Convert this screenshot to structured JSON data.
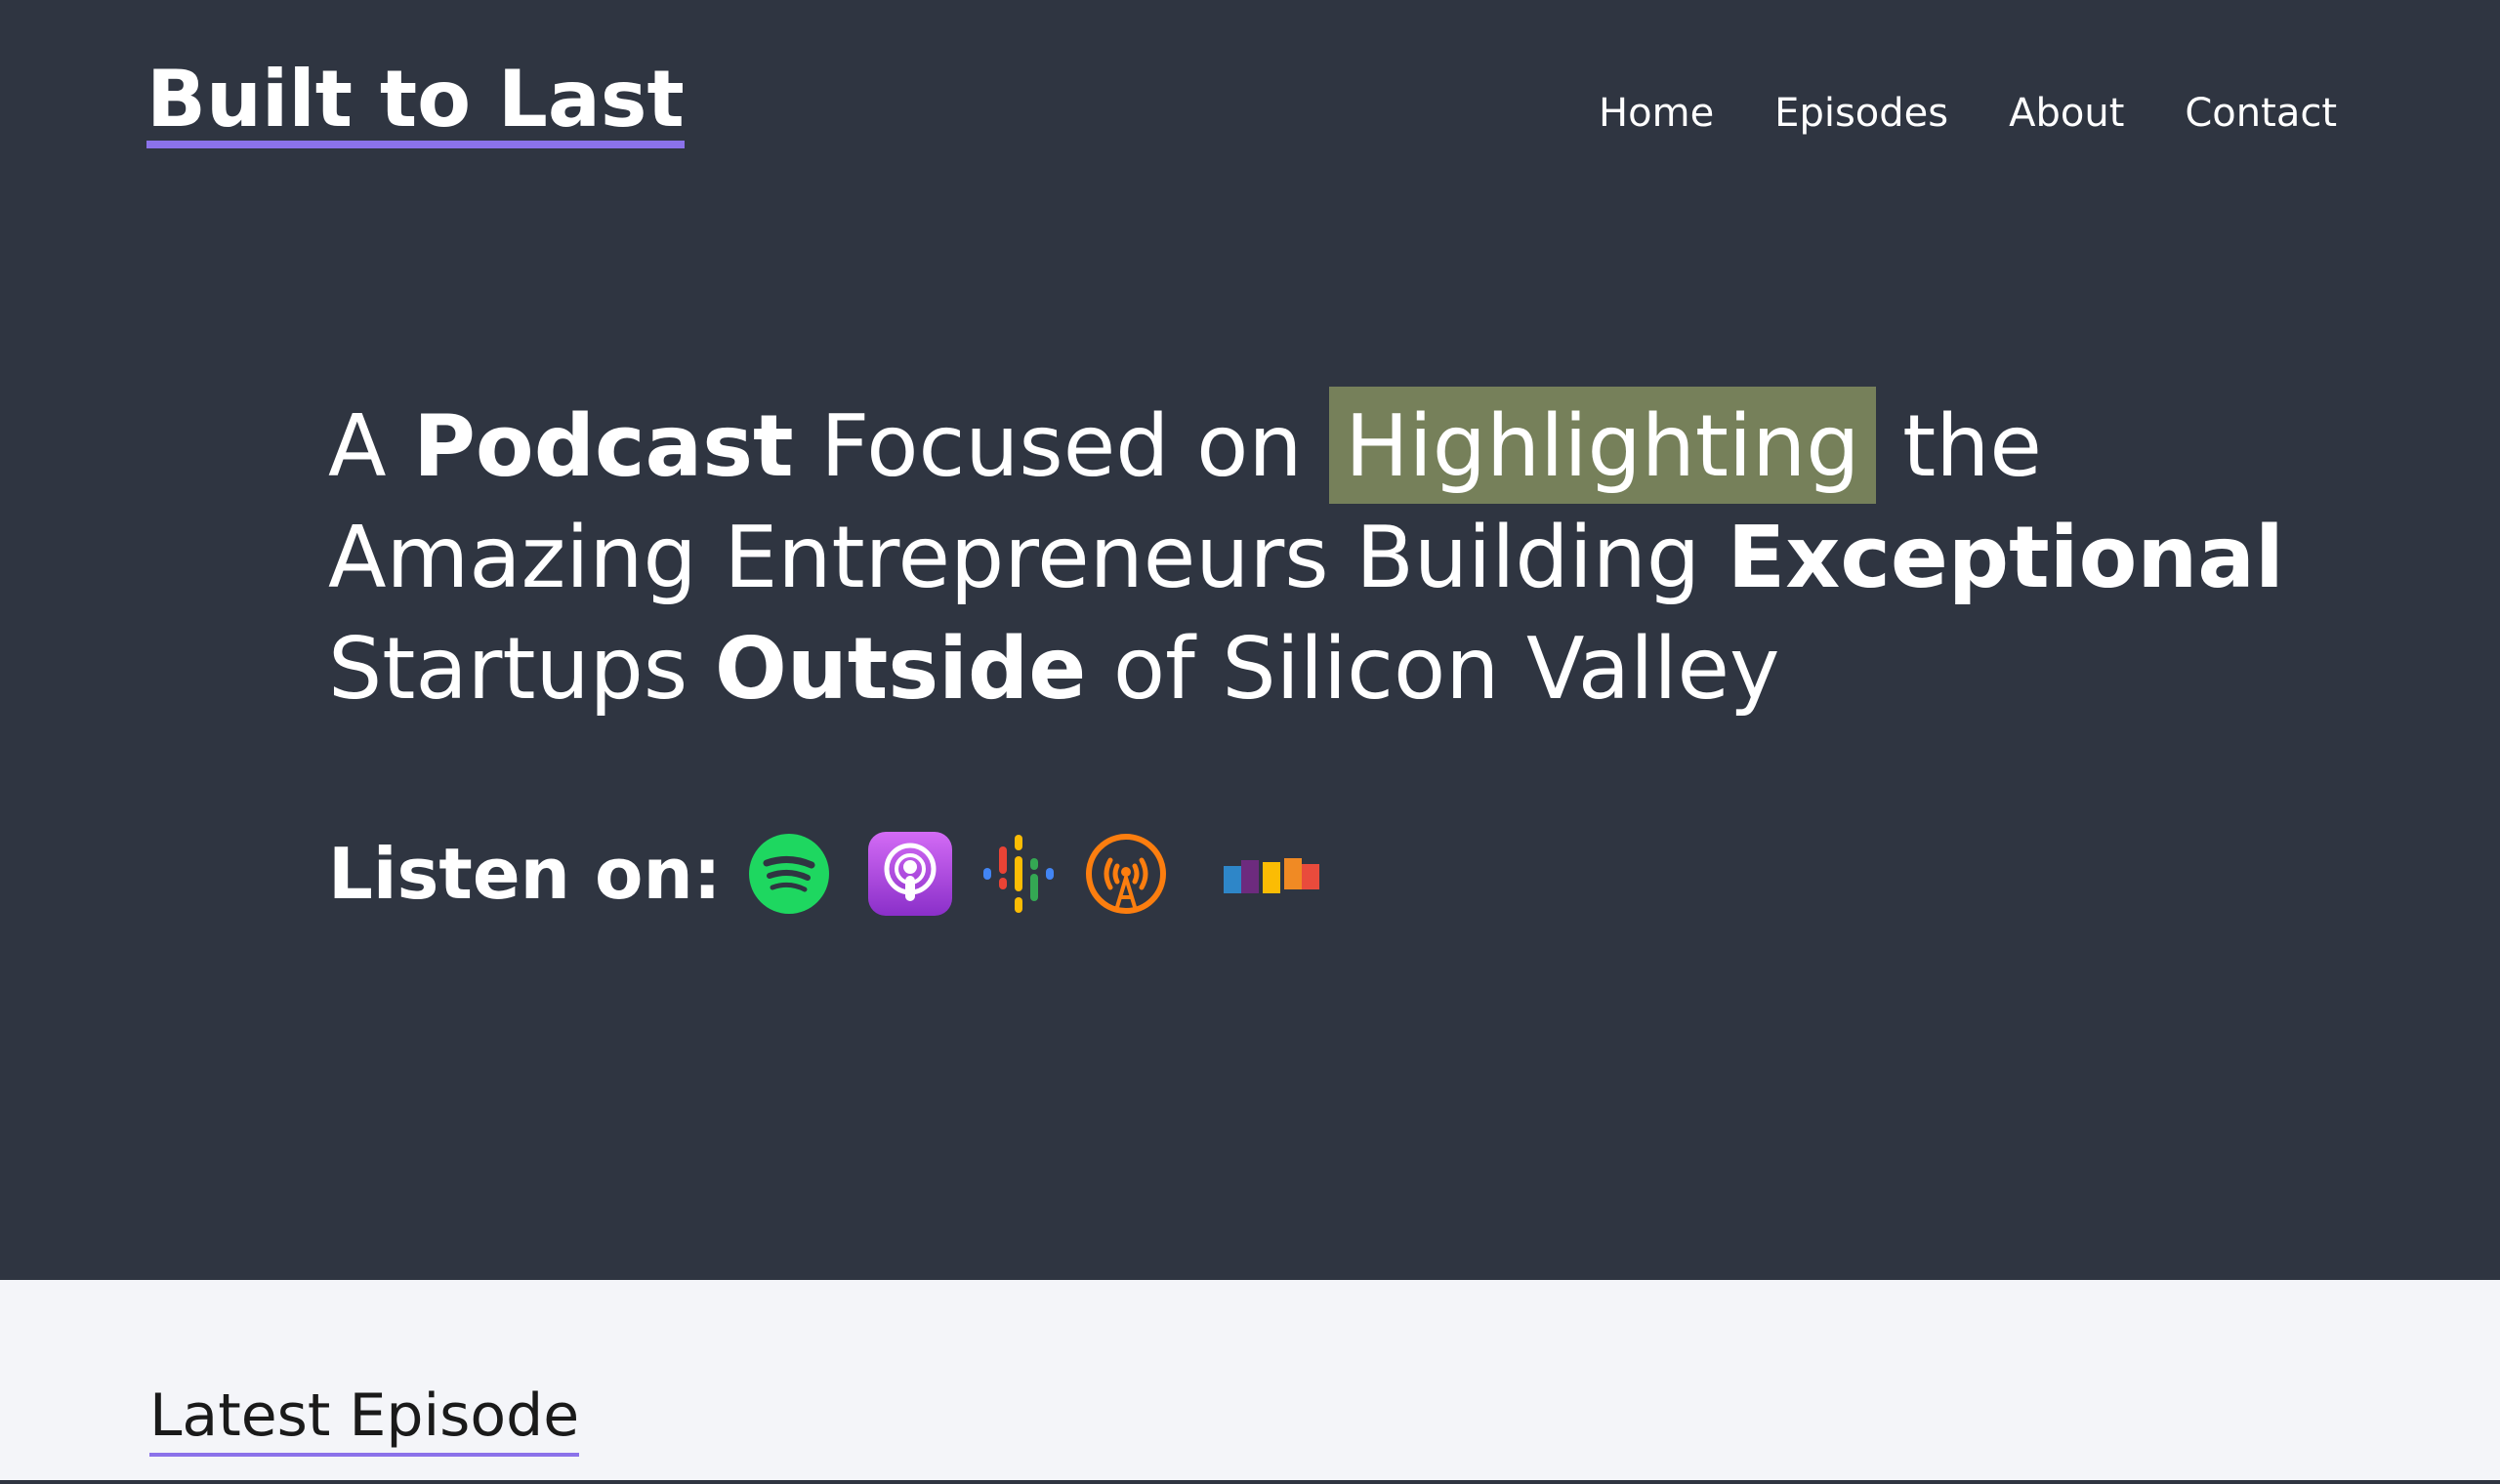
{
  "site": {
    "title": "Built to Last"
  },
  "nav": {
    "items": [
      "Home",
      "Episodes",
      "About",
      "Contact"
    ]
  },
  "hero": {
    "headline": {
      "w1": "A ",
      "w2": "Podcast",
      "w3": " Focused on ",
      "w4": "Highlighting",
      "w5": " the",
      "w6": "Amazing Entrepreneurs Building ",
      "w7": "Exceptional",
      "w8": "Startups ",
      "w9": "Outside",
      "w10": " of Silicon Valley"
    },
    "highlight_color": "#76805a",
    "listen_label": "Listen on:",
    "platforms": [
      {
        "icon": "spotify-icon",
        "color": "#1ed760"
      },
      {
        "icon": "apple-podcasts-icon",
        "color": "#9b3ad6"
      },
      {
        "icon": "google-podcasts-icon",
        "color": "#fbbc04"
      },
      {
        "icon": "overcast-icon",
        "color": "#fc7e0f"
      },
      {
        "icon": "castbox-icon",
        "color": "#e94b3c"
      }
    ]
  },
  "latest": {
    "heading": "Latest Episode"
  },
  "colors": {
    "hero_bg": "#2f3541",
    "accent": "#8b72ea",
    "lower_bg": "#f4f5f9"
  }
}
